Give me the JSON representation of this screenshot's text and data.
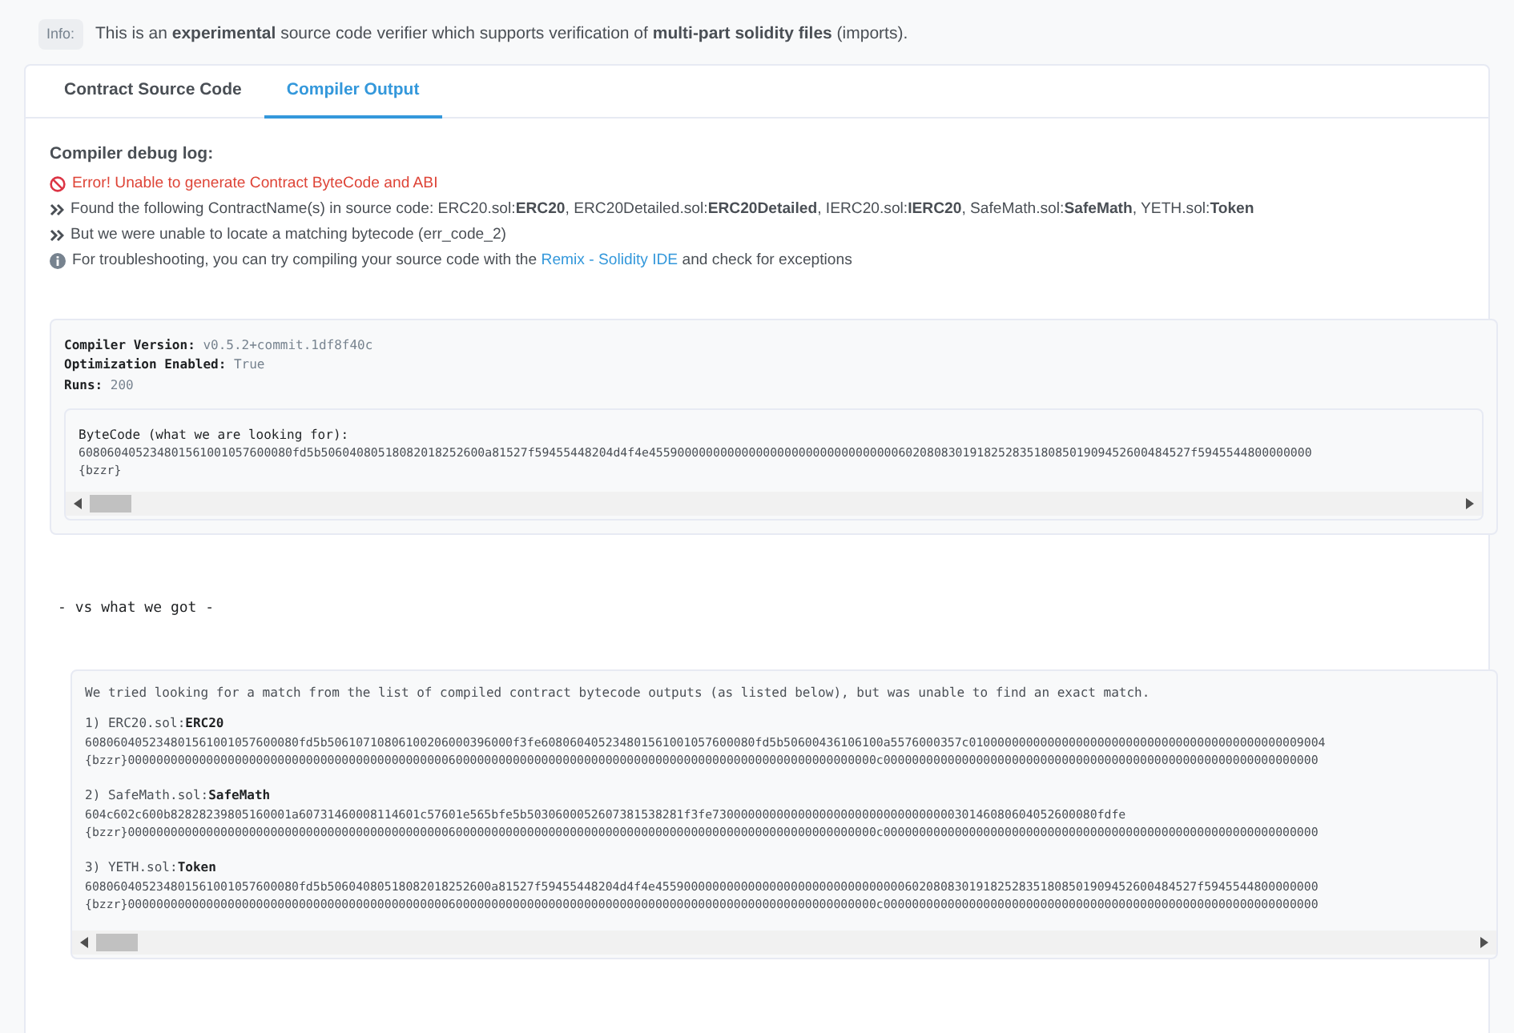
{
  "info": {
    "badge": "Info:",
    "text": "This is an **experimental** source code verifier which supports verification of **multi-part solidity files** (imports)."
  },
  "tabs": [
    {
      "label": "Contract Source Code",
      "selected": false
    },
    {
      "label": "Compiler Output",
      "selected": true
    }
  ],
  "debug_log": {
    "title": "Compiler debug log:",
    "lines": [
      {
        "kind": "error",
        "text": "Error! Unable to generate Contract ByteCode and ABI"
      },
      {
        "kind": "step",
        "text": "Found the following ContractName(s) in source code: ERC20.sol:**ERC20**, ERC20Detailed.sol:**ERC20Detailed**, IERC20.sol:**IERC20**, SafeMath.sol:**SafeMath**, YETH.sol:**Token**"
      },
      {
        "kind": "step",
        "text": "But we were unable to locate a matching bytecode (err_code_2)"
      },
      {
        "kind": "tip",
        "text": "For troubleshooting, you can try compiling your source code with the",
        "link": "Remix - Solidity IDE",
        "after": "and check for exceptions"
      }
    ]
  },
  "compiler_info": [
    {
      "key": "Compiler Version:",
      "value": "v0.5.2+commit.1df8f40c"
    },
    {
      "key": "Optimization Enabled:",
      "value": "True"
    },
    {
      "key": "Runs:",
      "value": "200"
    }
  ],
  "expected": {
    "title": "ByteCode (what we are looking for):",
    "lines": [
      "608060405234801561001057600080fd5b50604080518082018252600a81527f59455448204d4f4e4559000000000000000000000000000000060208083019182528351808501909452600484527f5945544800000000",
      "{bzzr}"
    ]
  },
  "separator": "- vs what we got -",
  "results": {
    "intro": "We tried looking for a match from the list of compiled contract bytecode outputs (as listed below), but was unable to find an exact match.",
    "items": [
      {
        "number": "1)",
        "file": "ERC20.sol:",
        "name": "ERC20",
        "lines": [
          "608060405234801561001057600080fd5b50610710806100206000396000f3fe608060405234801561001057600080fd5b50600436106100a5576000357c01000000000000000000000000000000000000000000009004",
          "{bzzr}000000000000000000000000000000000000000000000600000000000000000000000000000000000000000000000000000000000c0000000000000000000000000000000000000000000000000000000000000"
        ]
      },
      {
        "number": "2)",
        "file": "SafeMath.sol:",
        "name": "SafeMath",
        "lines": [
          "604c602c600b82828239805160001a60731460008114601c57601e565bfe5b5030600052607381538281f3fe730000000000000000000000000000000030146080604052600080fdfe",
          "{bzzr}000000000000000000000000000000000000000000000600000000000000000000000000000000000000000000000000000000000c0000000000000000000000000000000000000000000000000000000000000"
        ]
      },
      {
        "number": "3)",
        "file": "YETH.sol:",
        "name": "Token",
        "lines": [
          "608060405234801561001057600080fd5b50604080518082018252600a81527f59455448204d4f4e4559000000000000000000000000000000060208083019182528351808501909452600484527f5945544800000000",
          "{bzzr}000000000000000000000000000000000000000000000600000000000000000000000000000000000000000000000000000000000c0000000000000000000000000000000000000000000000000000000000000"
        ]
      }
    ]
  }
}
